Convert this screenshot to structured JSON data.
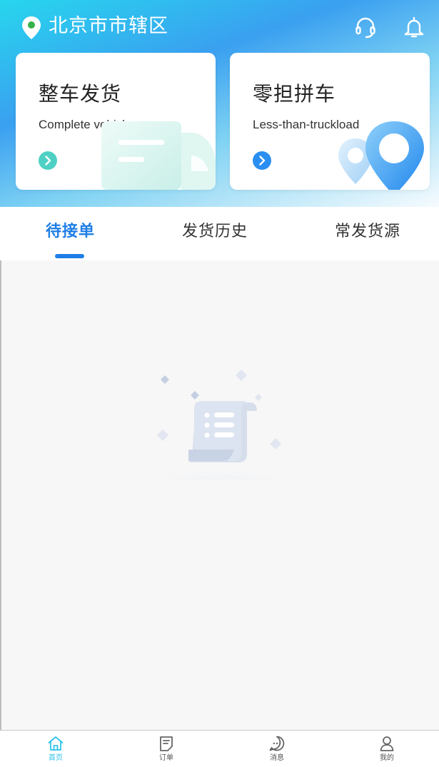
{
  "header": {
    "location": "北京市市辖区",
    "location_icon": "location-pin-icon",
    "support_icon": "headset-icon",
    "notification_icon": "bell-icon"
  },
  "cards": [
    {
      "title": "整车发货",
      "subtitle": "Complete vehicle",
      "icon": "chevron-right-icon",
      "accent": "#4fd0c4"
    },
    {
      "title": "零担拼车",
      "subtitle": "Less-than-truckload",
      "icon": "chevron-right-icon",
      "accent": "#2a8ff0"
    }
  ],
  "tabs": [
    {
      "label": "待接单",
      "active": true
    },
    {
      "label": "发货历史",
      "active": false
    },
    {
      "label": "常发货源",
      "active": false
    }
  ],
  "empty_state": {
    "icon": "empty-document-scroll-icon"
  },
  "bottom_nav": [
    {
      "label": "首页",
      "icon": "home-icon",
      "active": true
    },
    {
      "label": "订单",
      "icon": "order-icon",
      "active": false
    },
    {
      "label": "消息",
      "icon": "message-icon",
      "active": false
    },
    {
      "label": "我的",
      "icon": "profile-icon",
      "active": false
    }
  ],
  "colors": {
    "accent": "#1f7ee6",
    "nav_active": "#2fc3ea",
    "header_gradient_start": "#27d6ee",
    "header_gradient_end": "#3aa0f0"
  }
}
